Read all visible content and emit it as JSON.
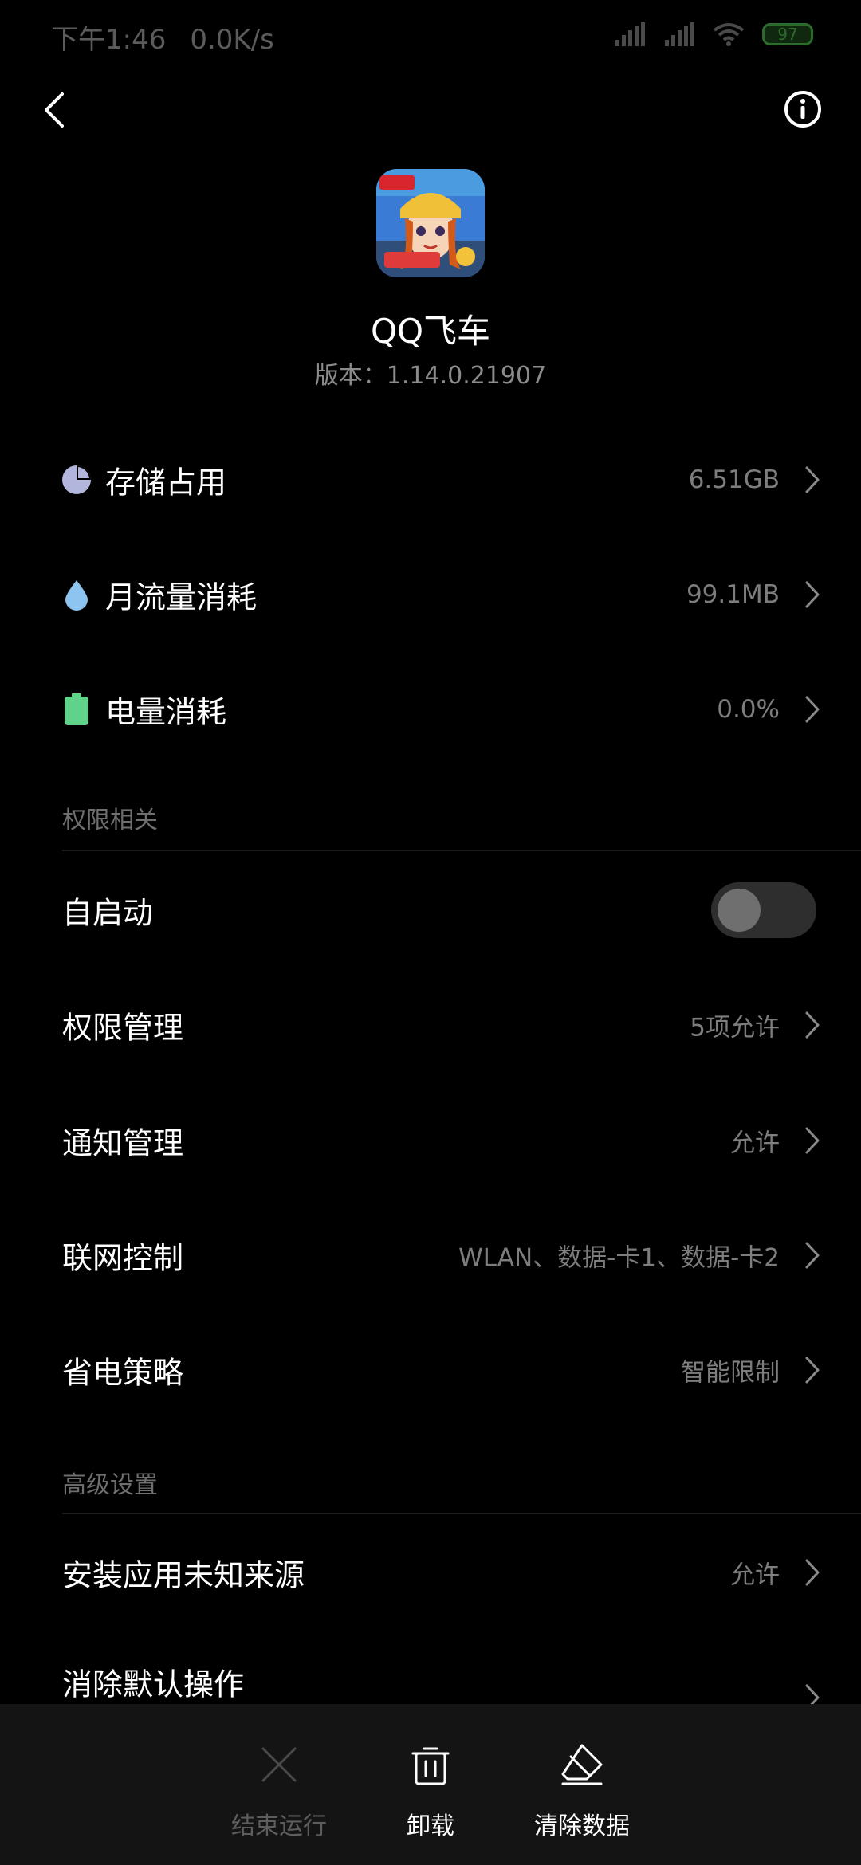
{
  "status_bar": {
    "time": "下午1:46",
    "speed": "0.0K/s",
    "battery": "97",
    "icons": [
      "signal-icon",
      "signal-icon",
      "wifi-icon",
      "battery-icon"
    ]
  },
  "header": {
    "back_icon": "back-arrow-icon",
    "info_icon": "info-icon"
  },
  "app": {
    "name": "QQ飞车",
    "version": "版本：1.14.0.21907"
  },
  "usage": [
    {
      "label": "存储占用",
      "value": "6.51GB",
      "icon": "pie-chart-icon",
      "icon_color": "#b3b6dc"
    },
    {
      "label": "月流量消耗",
      "value": "99.1MB",
      "icon": "droplet-icon",
      "icon_color": "#8ec5f0"
    },
    {
      "label": "电量消耗",
      "value": "0.0%",
      "icon": "battery-icon",
      "icon_color": "#5fd38a"
    }
  ],
  "permissions_section": {
    "title": "权限相关",
    "autostart": {
      "label": "自启动",
      "enabled": false
    },
    "items": [
      {
        "label": "权限管理",
        "value": "5项允许"
      },
      {
        "label": "通知管理",
        "value": "允许"
      },
      {
        "label": "联网控制",
        "value": "WLAN、数据-卡1、数据-卡2"
      },
      {
        "label": "省电策略",
        "value": "智能限制"
      }
    ]
  },
  "advanced_section": {
    "title": "高级设置",
    "items": [
      {
        "label": "安装应用未知来源",
        "value": "允许"
      },
      {
        "label": "消除默认操作",
        "value": ""
      }
    ]
  },
  "bottom_bar": {
    "actions": [
      {
        "label": "结束运行",
        "icon": "close-x-icon",
        "enabled": false
      },
      {
        "label": "卸载",
        "icon": "trash-icon",
        "enabled": true
      },
      {
        "label": "清除数据",
        "icon": "eraser-icon",
        "enabled": true
      }
    ]
  }
}
